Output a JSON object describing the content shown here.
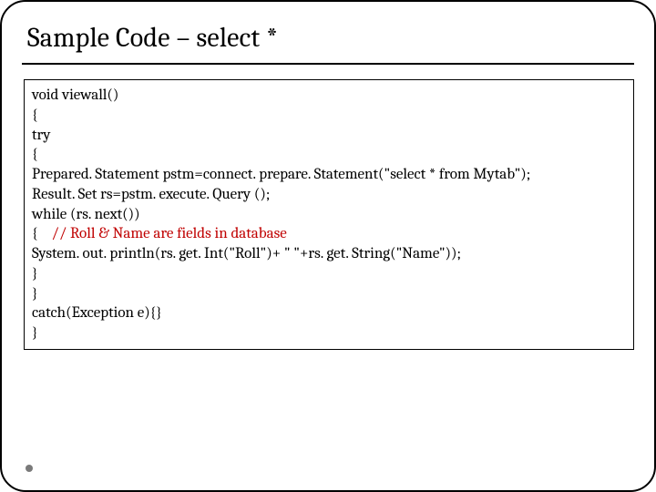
{
  "title": "Sample Code – select *",
  "code": {
    "l1": "void viewall()",
    "l2": "{",
    "l3": "try",
    "l4": "{",
    "l5": "Prepared. Statement pstm=connect. prepare. Statement(\"select * from Mytab\");",
    "l6": "Result. Set rs=pstm. execute. Query ();",
    "l7": "while (rs. next())",
    "l8_open": "{    ",
    "l8_comment": "// Roll & Name are fields in database",
    "l9": "System. out. println(rs. get. Int(\"Roll\")+ \" \"+rs. get. String(\"Name\"));",
    "l10": "}",
    "l11": "}",
    "l12": "catch(Exception e){}",
    "l13": "}"
  }
}
